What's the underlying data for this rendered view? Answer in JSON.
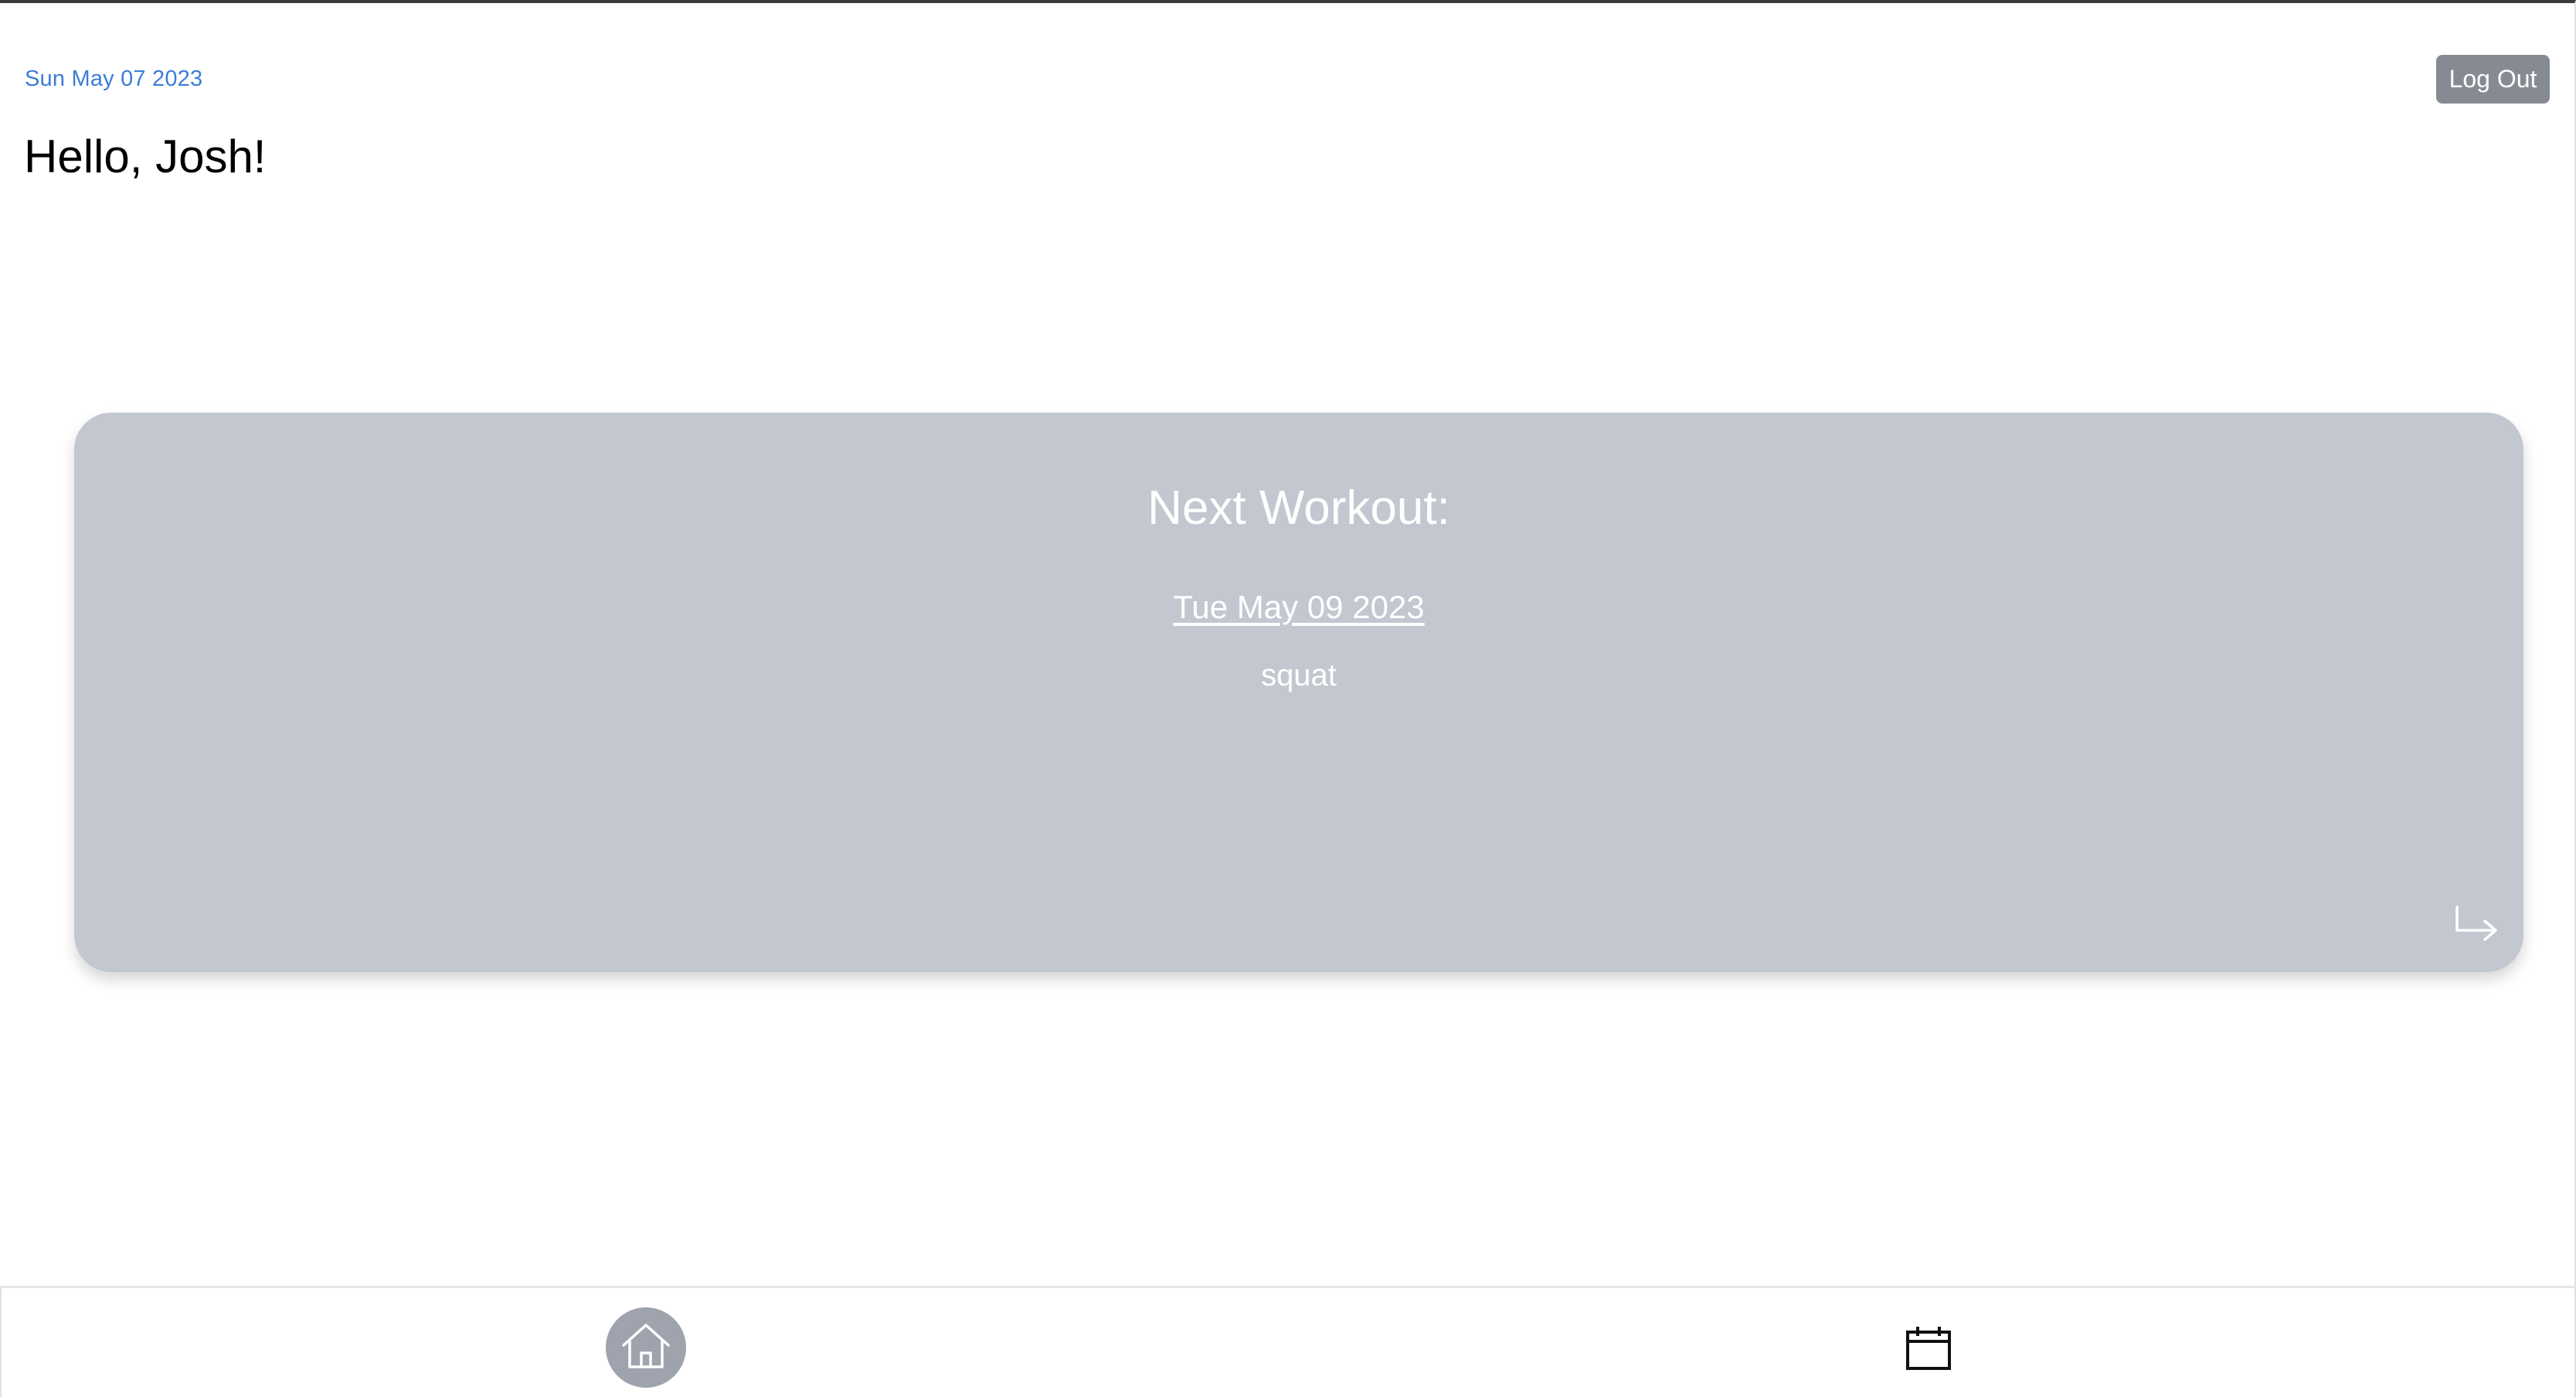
{
  "header": {
    "current_date": "Sun May 07 2023",
    "greeting": "Hello, Josh!",
    "logout_label": "Log Out"
  },
  "next_workout": {
    "title": "Next Workout:",
    "date": "Tue May 09 2023",
    "exercise": "squat",
    "arrow_icon": "corner-down-right-icon"
  },
  "bottom_nav": {
    "items": [
      {
        "icon": "home-icon",
        "active": true
      },
      {
        "icon": "calendar-icon",
        "active": false
      }
    ]
  },
  "colors": {
    "accent_date": "#3b7dd8",
    "card_bg": "#c3c7cf",
    "button_bg": "#868b93",
    "nav_active_bg": "#9ea3ad"
  }
}
